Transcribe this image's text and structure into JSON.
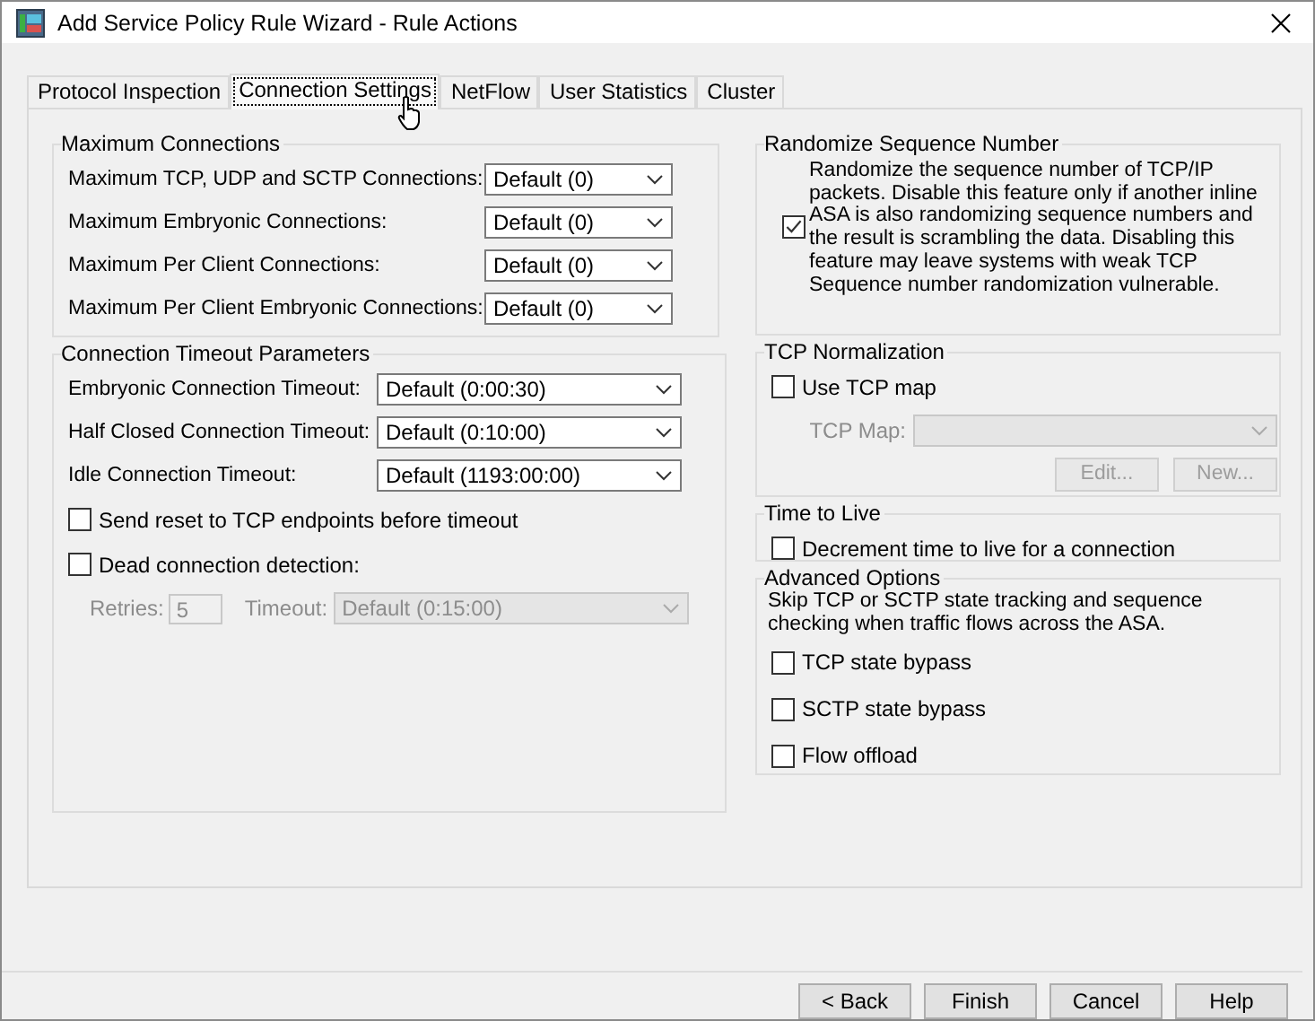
{
  "window": {
    "title": "Add Service Policy Rule Wizard - Rule Actions"
  },
  "tabs": [
    {
      "label": "Protocol Inspection",
      "selected": false
    },
    {
      "label": "Connection Settings",
      "selected": true
    },
    {
      "label": "NetFlow",
      "selected": false
    },
    {
      "label": "User Statistics",
      "selected": false
    },
    {
      "label": "Cluster",
      "selected": false
    }
  ],
  "max_connections": {
    "title": "Maximum Connections",
    "rows": [
      {
        "label": "Maximum TCP, UDP and SCTP Connections:",
        "value": "Default (0)"
      },
      {
        "label": "Maximum Embryonic Connections:",
        "value": "Default (0)"
      },
      {
        "label": "Maximum Per Client Connections:",
        "value": "Default (0)"
      },
      {
        "label": "Maximum Per Client Embryonic Connections:",
        "value": "Default (0)"
      }
    ]
  },
  "timeouts": {
    "title": "Connection Timeout Parameters",
    "rows": [
      {
        "label": "Embryonic Connection Timeout:",
        "value": "Default (0:00:30)"
      },
      {
        "label": "Half Closed Connection Timeout:",
        "value": "Default (0:10:00)"
      },
      {
        "label": "Idle Connection Timeout:",
        "value": "Default (1193:00:00)"
      }
    ],
    "checkboxes": [
      {
        "label": "Send reset to TCP endpoints before timeout",
        "checked": false
      },
      {
        "label": "Dead connection detection:",
        "checked": false
      }
    ],
    "retries": {
      "label": "Retries:",
      "value": "5",
      "disabled": true
    },
    "timeout": {
      "label": "Timeout:",
      "value": "Default (0:15:00)",
      "disabled": true
    }
  },
  "randomize": {
    "title": "Randomize Sequence Number",
    "checked": true,
    "text": "Randomize the sequence number of TCP/IP packets. Disable this feature only if another inline ASA is also randomizing sequence numbers and the result is scrambling the data. Disabling this feature may leave systems with weak TCP Sequence number randomization vulnerable."
  },
  "tcp_normalization": {
    "title": "TCP Normalization",
    "use_map": {
      "label": "Use TCP map",
      "checked": false
    },
    "map_label": "TCP Map:",
    "disabled": true,
    "buttons": [
      "Edit...",
      "New..."
    ]
  },
  "time_to_live": {
    "title": "Time to Live",
    "option": {
      "label": "Decrement time to live for a connection",
      "checked": false
    }
  },
  "advanced": {
    "title": "Advanced Options",
    "description": "Skip TCP or SCTP state tracking and sequence checking when traffic flows across the ASA.",
    "options": [
      {
        "label": "TCP state bypass",
        "checked": false
      },
      {
        "label": "SCTP state bypass",
        "checked": false
      },
      {
        "label": "Flow offload",
        "checked": false
      }
    ]
  },
  "footer_buttons": [
    "< Back",
    "Finish",
    "Cancel",
    "Help"
  ]
}
